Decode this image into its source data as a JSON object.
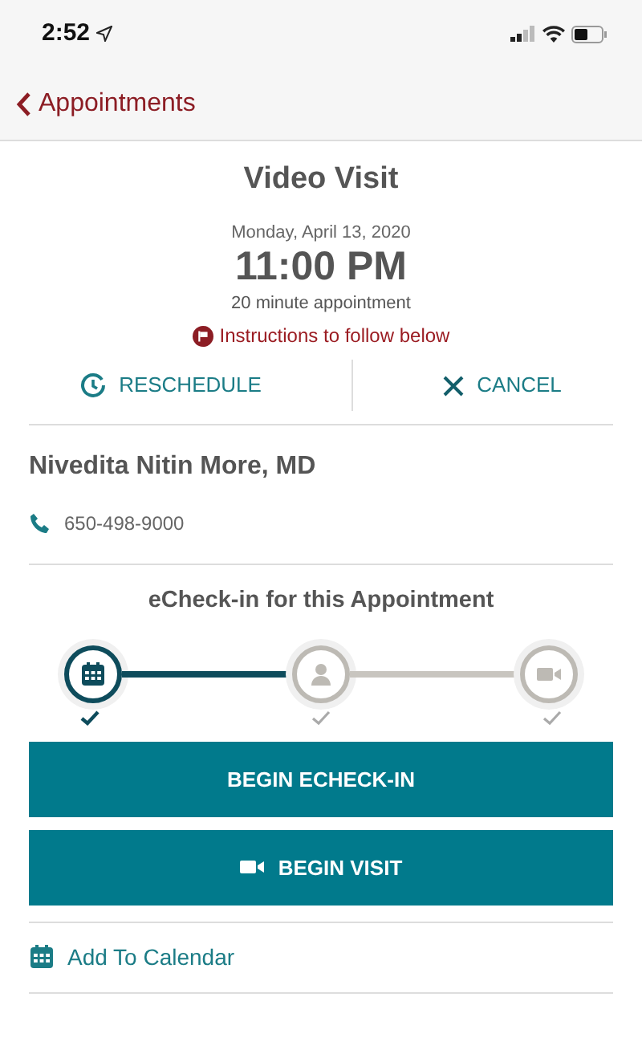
{
  "status_bar": {
    "time": "2:52"
  },
  "nav": {
    "back_label": "Appointments"
  },
  "appointment": {
    "title": "Video Visit",
    "date": "Monday, April 13, 2020",
    "time": "11:00 PM",
    "duration": "20 minute appointment",
    "notice": "Instructions to follow below"
  },
  "actions": [
    {
      "kind": "reschedule",
      "label": "RESCHEDULE"
    },
    {
      "kind": "cancel",
      "label": "CANCEL"
    }
  ],
  "provider": {
    "name": "Nivedita Nitin More, MD",
    "phone": "650-498-9000"
  },
  "echeck": {
    "title": "eCheck-in for this Appointment",
    "steps": [
      {
        "kind": "calendar",
        "done": true
      },
      {
        "kind": "person",
        "done": false
      },
      {
        "kind": "video",
        "done": false
      }
    ]
  },
  "buttons": [
    {
      "kind": "plain",
      "label": "BEGIN ECHECK-IN"
    },
    {
      "kind": "video",
      "label": "BEGIN VISIT"
    }
  ],
  "links": [
    {
      "kind": "calendar",
      "label": "Add To Calendar"
    }
  ]
}
